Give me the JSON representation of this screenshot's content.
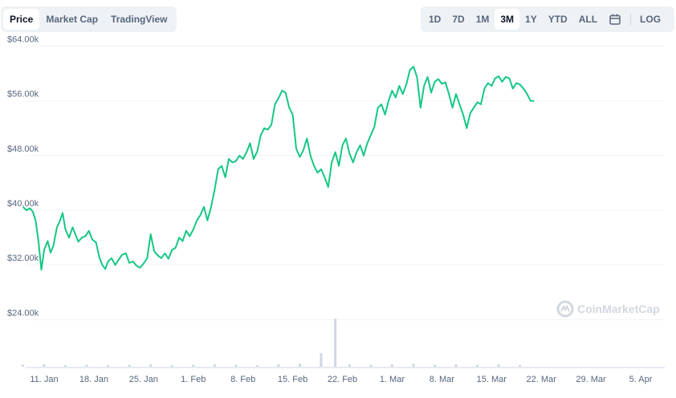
{
  "tabs_left": [
    {
      "label": "Price",
      "active": true
    },
    {
      "label": "Market Cap",
      "active": false
    },
    {
      "label": "TradingView",
      "active": false
    }
  ],
  "tabs_right": [
    {
      "label": "1D",
      "active": false
    },
    {
      "label": "7D",
      "active": false
    },
    {
      "label": "1M",
      "active": false
    },
    {
      "label": "3M",
      "active": true
    },
    {
      "label": "1Y",
      "active": false
    },
    {
      "label": "YTD",
      "active": false
    },
    {
      "label": "ALL",
      "active": false
    }
  ],
  "log_label": "LOG",
  "watermark": "CoinMarketCap",
  "colors": {
    "line": "#16c784",
    "grid": "#eff2f5",
    "volume": "#cfd6e4",
    "text": "#58667e"
  },
  "chart_data": {
    "type": "line",
    "grid": true,
    "ylim": [
      17000,
      67000
    ],
    "y_ticks": [
      {
        "value": 24000,
        "label": "$24.00k"
      },
      {
        "value": 32000,
        "label": "$32.00k"
      },
      {
        "value": 40000,
        "label": "$40.00k"
      },
      {
        "value": 48000,
        "label": "$48.00k"
      },
      {
        "value": 56000,
        "label": "$56.00k"
      },
      {
        "value": 64000,
        "label": "$64.00k"
      }
    ],
    "x_ticks": [
      "11. Jan",
      "18. Jan",
      "25. Jan",
      "1. Feb",
      "8. Feb",
      "15. Feb",
      "22. Feb",
      "1. Mar",
      "8. Mar",
      "15. Mar",
      "22. Mar",
      "29. Mar",
      "5. Apr"
    ],
    "x_start": "2021-01-08",
    "series": [
      {
        "values": [
          [
            0,
            40500
          ],
          [
            0.5,
            40000
          ],
          [
            1,
            40300
          ],
          [
            1.4,
            39800
          ],
          [
            1.8,
            38500
          ],
          [
            2.2,
            35500
          ],
          [
            2.6,
            31300
          ],
          [
            3,
            34200
          ],
          [
            3.5,
            35500
          ],
          [
            3.9,
            33800
          ],
          [
            4.3,
            34800
          ],
          [
            4.8,
            37500
          ],
          [
            5.2,
            38400
          ],
          [
            5.6,
            39600
          ],
          [
            6,
            37200
          ],
          [
            6.5,
            36000
          ],
          [
            7,
            37500
          ],
          [
            7.4,
            36500
          ],
          [
            7.8,
            35400
          ],
          [
            8.3,
            36000
          ],
          [
            8.8,
            36200
          ],
          [
            9.3,
            37000
          ],
          [
            9.8,
            35700
          ],
          [
            10.3,
            35300
          ],
          [
            10.8,
            33000
          ],
          [
            11.2,
            32000
          ],
          [
            11.6,
            31400
          ],
          [
            12,
            32500
          ],
          [
            12.5,
            33000
          ],
          [
            13,
            32000
          ],
          [
            13.5,
            32800
          ],
          [
            14,
            33500
          ],
          [
            14.5,
            33700
          ],
          [
            15,
            32300
          ],
          [
            15.5,
            32500
          ],
          [
            16,
            31900
          ],
          [
            16.5,
            31600
          ],
          [
            17,
            32200
          ],
          [
            17.5,
            33000
          ],
          [
            18,
            36500
          ],
          [
            18.5,
            34000
          ],
          [
            19,
            33400
          ],
          [
            19.5,
            33000
          ],
          [
            20,
            33700
          ],
          [
            20.5,
            32900
          ],
          [
            21,
            34200
          ],
          [
            21.5,
            34500
          ],
          [
            22,
            36000
          ],
          [
            22.5,
            35500
          ],
          [
            23,
            37000
          ],
          [
            23.5,
            36200
          ],
          [
            24,
            37200
          ],
          [
            24.5,
            38500
          ],
          [
            25,
            39300
          ],
          [
            25.5,
            40500
          ],
          [
            26,
            38500
          ],
          [
            26.5,
            40500
          ],
          [
            27,
            43000
          ],
          [
            27.5,
            46000
          ],
          [
            28,
            46500
          ],
          [
            28.5,
            44800
          ],
          [
            29,
            47500
          ],
          [
            29.5,
            47000
          ],
          [
            30,
            47200
          ],
          [
            30.5,
            48000
          ],
          [
            31,
            47500
          ],
          [
            31.5,
            48500
          ],
          [
            32,
            49800
          ],
          [
            32.5,
            47500
          ],
          [
            33,
            48600
          ],
          [
            33.5,
            51000
          ],
          [
            34,
            52000
          ],
          [
            34.5,
            51800
          ],
          [
            35,
            52500
          ],
          [
            35.5,
            55500
          ],
          [
            36,
            56400
          ],
          [
            36.5,
            57500
          ],
          [
            37,
            57200
          ],
          [
            37.5,
            55000
          ],
          [
            38,
            54000
          ],
          [
            38.5,
            49000
          ],
          [
            39,
            47800
          ],
          [
            39.5,
            48800
          ],
          [
            40,
            50500
          ],
          [
            40.5,
            48000
          ],
          [
            41,
            46500
          ],
          [
            41.5,
            45500
          ],
          [
            42,
            46000
          ],
          [
            42.5,
            44800
          ],
          [
            43,
            43400
          ],
          [
            43.5,
            47000
          ],
          [
            44,
            48500
          ],
          [
            44.5,
            46500
          ],
          [
            45,
            49500
          ],
          [
            45.5,
            50500
          ],
          [
            46,
            48300
          ],
          [
            46.5,
            47000
          ],
          [
            47,
            48500
          ],
          [
            47.5,
            49500
          ],
          [
            48,
            48000
          ],
          [
            48.5,
            49800
          ],
          [
            49,
            51000
          ],
          [
            49.5,
            52200
          ],
          [
            50,
            55000
          ],
          [
            50.5,
            55500
          ],
          [
            51,
            54000
          ],
          [
            51.5,
            56000
          ],
          [
            52,
            57500
          ],
          [
            52.5,
            56500
          ],
          [
            53,
            58200
          ],
          [
            53.5,
            57000
          ],
          [
            54,
            58400
          ],
          [
            54.5,
            60500
          ],
          [
            55,
            61000
          ],
          [
            55.5,
            59500
          ],
          [
            56,
            55000
          ],
          [
            56.5,
            58200
          ],
          [
            57,
            59500
          ],
          [
            57.5,
            57200
          ],
          [
            58,
            58800
          ],
          [
            58.5,
            59200
          ],
          [
            59,
            58500
          ],
          [
            59.5,
            58700
          ],
          [
            60,
            57000
          ],
          [
            60.5,
            55000
          ],
          [
            61,
            57000
          ],
          [
            61.5,
            55500
          ],
          [
            62,
            54000
          ],
          [
            62.5,
            52000
          ],
          [
            63,
            54200
          ],
          [
            63.5,
            55000
          ],
          [
            64,
            55800
          ],
          [
            64.5,
            55500
          ],
          [
            65,
            57800
          ],
          [
            65.5,
            58600
          ],
          [
            66,
            58200
          ],
          [
            66.5,
            59300
          ],
          [
            67,
            59600
          ],
          [
            67.5,
            58800
          ],
          [
            68,
            59500
          ],
          [
            68.5,
            59300
          ],
          [
            69,
            57800
          ],
          [
            69.5,
            58600
          ],
          [
            70,
            58400
          ],
          [
            70.5,
            57800
          ],
          [
            71,
            57000
          ],
          [
            71.5,
            56000
          ],
          [
            72,
            56000
          ]
        ]
      }
    ],
    "volume": [
      [
        0,
        0.04
      ],
      [
        3,
        0.05
      ],
      [
        6,
        0.03
      ],
      [
        9,
        0.04
      ],
      [
        12,
        0.03
      ],
      [
        15,
        0.04
      ],
      [
        18,
        0.05
      ],
      [
        21,
        0.03
      ],
      [
        24,
        0.04
      ],
      [
        27,
        0.05
      ],
      [
        30,
        0.04
      ],
      [
        33,
        0.03
      ],
      [
        36,
        0.05
      ],
      [
        39,
        0.06
      ],
      [
        42,
        0.28
      ],
      [
        44,
        1.0
      ],
      [
        46,
        0.05
      ],
      [
        49,
        0.04
      ],
      [
        52,
        0.05
      ],
      [
        55,
        0.06
      ],
      [
        58,
        0.04
      ],
      [
        61,
        0.05
      ],
      [
        64,
        0.04
      ],
      [
        67,
        0.05
      ],
      [
        70,
        0.04
      ]
    ]
  }
}
